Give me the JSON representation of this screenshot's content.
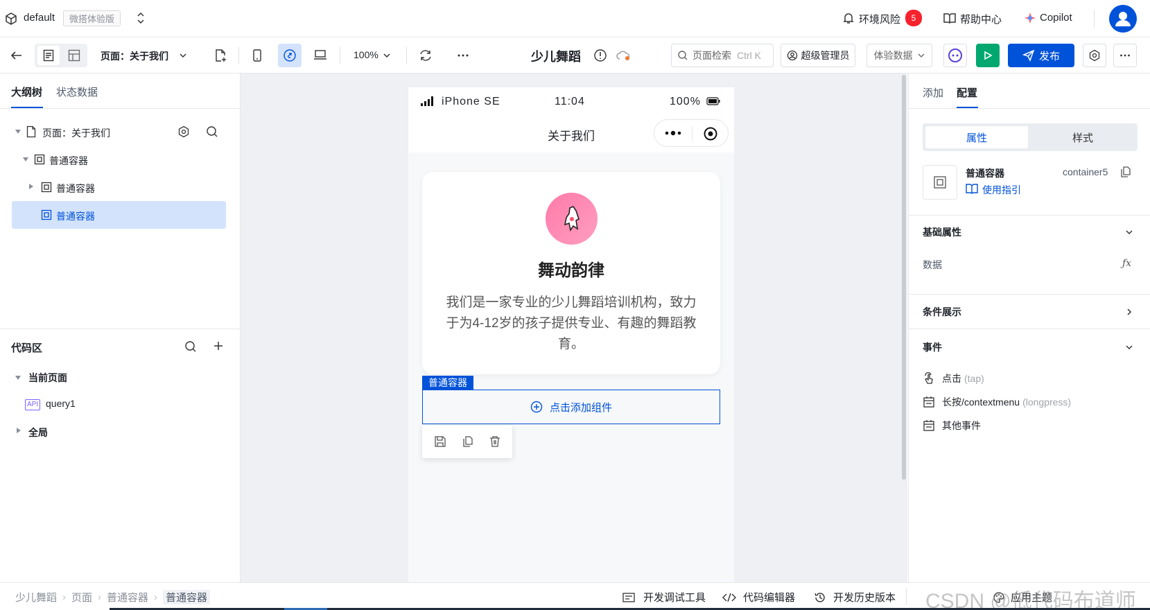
{
  "app": {
    "env_name": "default",
    "env_tag": "微搭体验版",
    "risk_label": "环境风险",
    "risk_count": "5",
    "help_label": "帮助中心",
    "copilot_label": "Copilot"
  },
  "toolbar": {
    "page_select": "页面：关于我们",
    "zoom": "100%",
    "app_title": "少儿舞蹈",
    "search_placeholder": "页面检索",
    "search_shortcut": "Ctrl K",
    "role_label": "超级管理员",
    "data_select": "体验数据",
    "publish_label": "发布"
  },
  "left": {
    "tabs": [
      "大纲树",
      "状态数据"
    ],
    "tree": [
      {
        "label": "页面：关于我们"
      },
      {
        "label": "普通容器"
      },
      {
        "label": "普通容器"
      },
      {
        "label": "普通容器"
      }
    ],
    "code_title": "代码区",
    "current_page": "当前页面",
    "api_badge": "API",
    "query_name": "query1",
    "global_label": "全局"
  },
  "phone": {
    "device": "iPhone SE",
    "time": "11:04",
    "battery": "100%",
    "nav_title": "关于我们",
    "card_title": "舞动韵律",
    "card_desc": "我们是一家专业的少儿舞蹈培训机构，致力于为4-12岁的孩子提供专业、有趣的舞蹈教育。",
    "selected_tag": "普通容器",
    "add_component": "点击添加组件"
  },
  "right": {
    "tabs": [
      "添加",
      "配置"
    ],
    "seg": [
      "属性",
      "样式"
    ],
    "component_name": "普通容器",
    "component_id": "container5",
    "guide_link": "使用指引",
    "basic_props": "基础属性",
    "data_label": "数据",
    "fx_label": "ƒx",
    "condition": "条件展示",
    "events": "事件",
    "event_tap": "点击",
    "event_tap_code": "(tap)",
    "event_long": "长按/contextmenu",
    "event_long_code": "(longpress)",
    "event_other": "其他事件"
  },
  "bottom": {
    "breadcrumb": [
      "少儿舞蹈",
      "页面",
      "普通容器",
      "普通容器"
    ],
    "debug": "开发调试工具",
    "code_editor": "代码编辑器",
    "history": "开发历史版本",
    "theme": "应用主题",
    "watermark": "CSDN @低代码布道师"
  },
  "colors": {
    "accent": "#0052d9",
    "run_green": "#00a870",
    "danger": "#f5222d",
    "selected_bg": "#d4e3fc"
  }
}
